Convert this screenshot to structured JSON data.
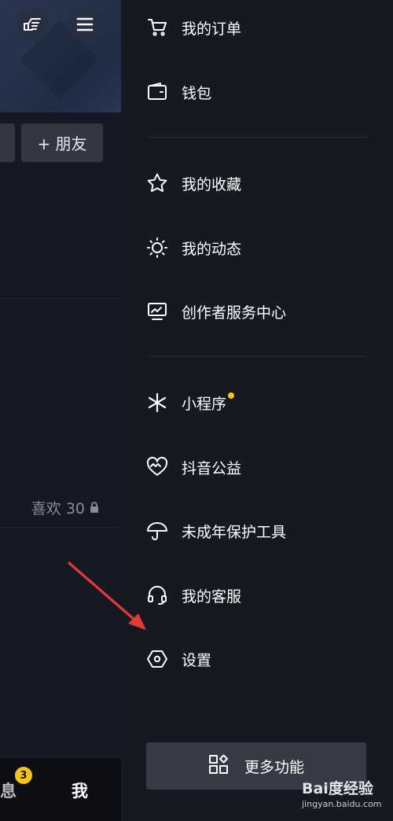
{
  "left_page": {
    "friend_button": "+ 朋友",
    "likes": "喜欢 30",
    "bottom_nav": {
      "messages_label": "息",
      "messages_badge": "3",
      "me_label": "我"
    }
  },
  "drawer": {
    "items": [
      {
        "label": "我的订单",
        "icon": "cart-icon"
      },
      {
        "label": "钱包",
        "icon": "wallet-icon"
      },
      {
        "label": "我的收藏",
        "icon": "star-icon"
      },
      {
        "label": "我的动态",
        "icon": "sun-icon"
      },
      {
        "label": "创作者服务中心",
        "icon": "creator-monitor-icon"
      },
      {
        "label": "小程序",
        "icon": "mini-program-icon"
      },
      {
        "label": "抖音公益",
        "icon": "charity-heart-icon"
      },
      {
        "label": "未成年保护工具",
        "icon": "umbrella-icon"
      },
      {
        "label": "我的客服",
        "icon": "headset-icon"
      },
      {
        "label": "设置",
        "icon": "settings-hexagon-icon"
      }
    ],
    "more_button": "更多功能"
  },
  "watermark": {
    "main": "Bai度经验",
    "sub": "jingyan.baidu.com"
  },
  "colors": {
    "background": "#161822",
    "accent_dot": "#f5c518",
    "arrow": "#e53935",
    "button": "#373945"
  }
}
